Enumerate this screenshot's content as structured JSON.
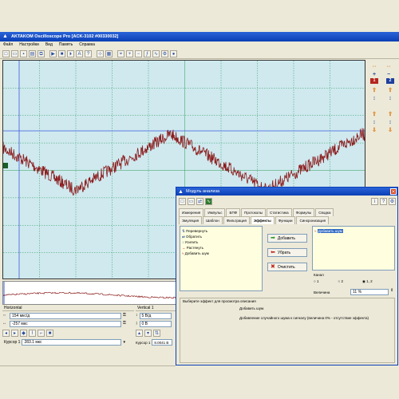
{
  "app": {
    "title": "AKTAKOM Oscilloscope Pro [ACK-3102 #00330032]"
  },
  "menu": [
    "Файл",
    "Настройки",
    "Вид",
    "Память",
    "Справка"
  ],
  "right_panel": {
    "channel1": "1",
    "channel2": "2"
  },
  "horizontal": {
    "title": "Horizontal",
    "timebase": "154 мкс/д",
    "offset": "-257 мкс",
    "cursor_label": "Курсор 1",
    "cursor_value": "283.1 мкс"
  },
  "vertical": {
    "title": "Vertical 1",
    "scale": "5 В/д",
    "offset": "0 В",
    "cursor_label": "Курсор 1",
    "cursor_value": "8.0041 В"
  },
  "dialog": {
    "title": "Модуль анализа",
    "tabs_row1": [
      "Измерения",
      "Импульс",
      "БПФ",
      "Протоколы",
      "Статистика",
      "Формулы",
      "Сводка"
    ],
    "tabs_row2": [
      "Эмуляция",
      "Шаблон",
      "Фильтрация",
      "Эффекты",
      "Функции",
      "Синхронизация"
    ],
    "active_tab": "Эффекты",
    "effects_list": [
      "Перевернуть",
      "Обратить",
      "Усилить",
      "Растянуть",
      "Добавить шум"
    ],
    "add_button": "Добавить",
    "remove_button": "Убрать",
    "clear_button": "Очистить",
    "applied_list": [
      "Добавить шум"
    ],
    "channel_label": "Канал",
    "channel_options": [
      "1",
      "2",
      "1, 2"
    ],
    "magnitude_label": "Величина",
    "magnitude_value": "11 %",
    "description_caption": "Выберите эффект для просмотра описания",
    "description_title": "Добавить шум.",
    "description_text": "Добавление случайного шума к сигналу (величина 0% - отсутствие эффекта)"
  },
  "colors": {
    "trace": "#8b1a1a",
    "grid": "#2d9a57",
    "cursor_line": "#3b5bdb",
    "screen_bg": "#cfe9ef"
  },
  "signal": {
    "type": "triangle wave with noise",
    "noise_percent": 11
  }
}
